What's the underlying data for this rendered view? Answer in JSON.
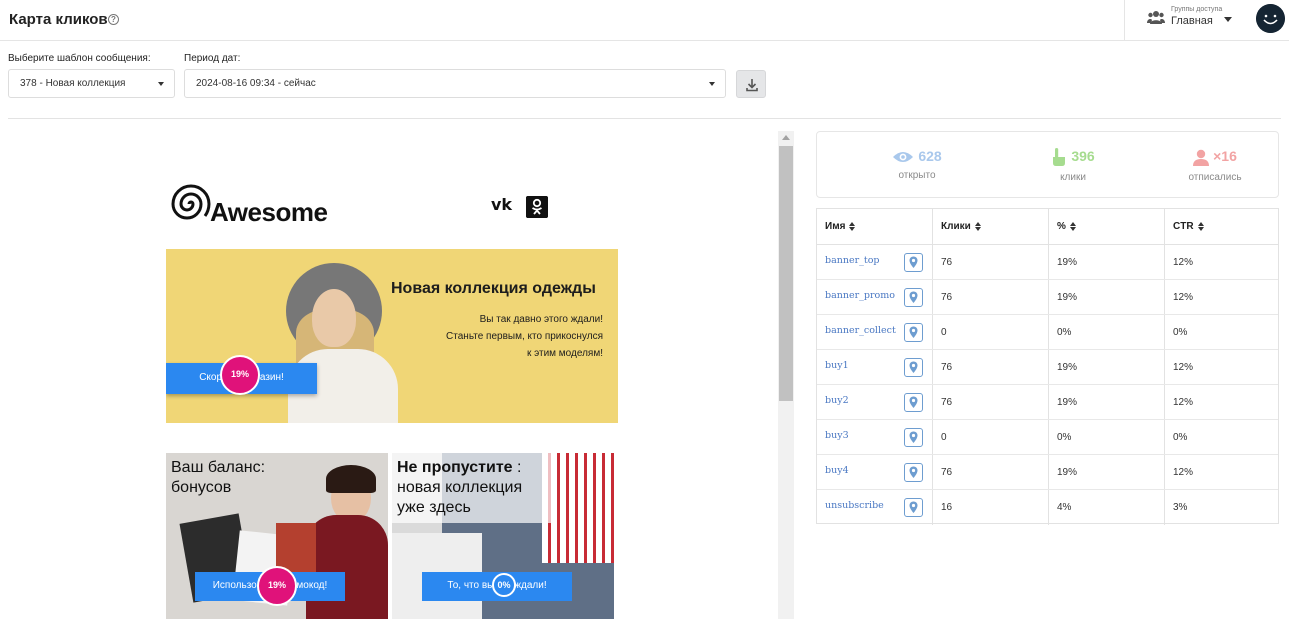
{
  "header": {
    "title": "Карта кликов",
    "access_caption": "Группы доступа",
    "access_value": "Главная"
  },
  "filters": {
    "template_label": "Выберите шаблон сообщения:",
    "template_value": "378 - Новая коллекция",
    "period_label": "Период дат:",
    "period_value": "2024-08-16 09:34 - сейчас"
  },
  "email": {
    "logo_text": "Awesome",
    "social": [
      "vk-icon",
      "odnoklassniki-icon"
    ],
    "hero": {
      "title": "Новая коллекция одежды",
      "subtitle_lines": [
        "Вы так давно этого ждали!",
        "Станьте первым, кто прикоснулся",
        "к этим моделям!"
      ],
      "button_label": "Скорее в магазин!",
      "badge": "19%"
    },
    "card_left": {
      "text_lines": [
        "Ваш баланс:",
        "бонусов"
      ],
      "button_label": "Использовать промокод!",
      "badge": "19%"
    },
    "card_right": {
      "text_bold": "Не пропустите",
      "text_rest": " :",
      "text_lines": [
        "новая коллекция",
        "уже здесь"
      ],
      "button_label": "То, что вы так ждали!",
      "badge": "0%"
    }
  },
  "stats": {
    "opened": {
      "value": "628",
      "label": "открыто",
      "color": "#a9c8ec"
    },
    "clicks": {
      "value": "396",
      "label": "клики",
      "color": "#a6dc8f"
    },
    "unsub": {
      "value": "×16",
      "label": "отписались",
      "color": "#f2a3a3"
    }
  },
  "table": {
    "headers": [
      "Имя",
      "Клики",
      "%",
      "CTR"
    ],
    "rows": [
      {
        "name": "banner_top",
        "clicks": "76",
        "pct": "19%",
        "ctr": "12%"
      },
      {
        "name": "banner_promo",
        "clicks": "76",
        "pct": "19%",
        "ctr": "12%"
      },
      {
        "name": "banner_collect",
        "clicks": "0",
        "pct": "0%",
        "ctr": "0%"
      },
      {
        "name": "buy1",
        "clicks": "76",
        "pct": "19%",
        "ctr": "12%"
      },
      {
        "name": "buy2",
        "clicks": "76",
        "pct": "19%",
        "ctr": "12%"
      },
      {
        "name": "buy3",
        "clicks": "0",
        "pct": "0%",
        "ctr": "0%"
      },
      {
        "name": "buy4",
        "clicks": "76",
        "pct": "19%",
        "ctr": "12%"
      },
      {
        "name": "unsubscribe",
        "clicks": "16",
        "pct": "4%",
        "ctr": "3%"
      }
    ]
  }
}
